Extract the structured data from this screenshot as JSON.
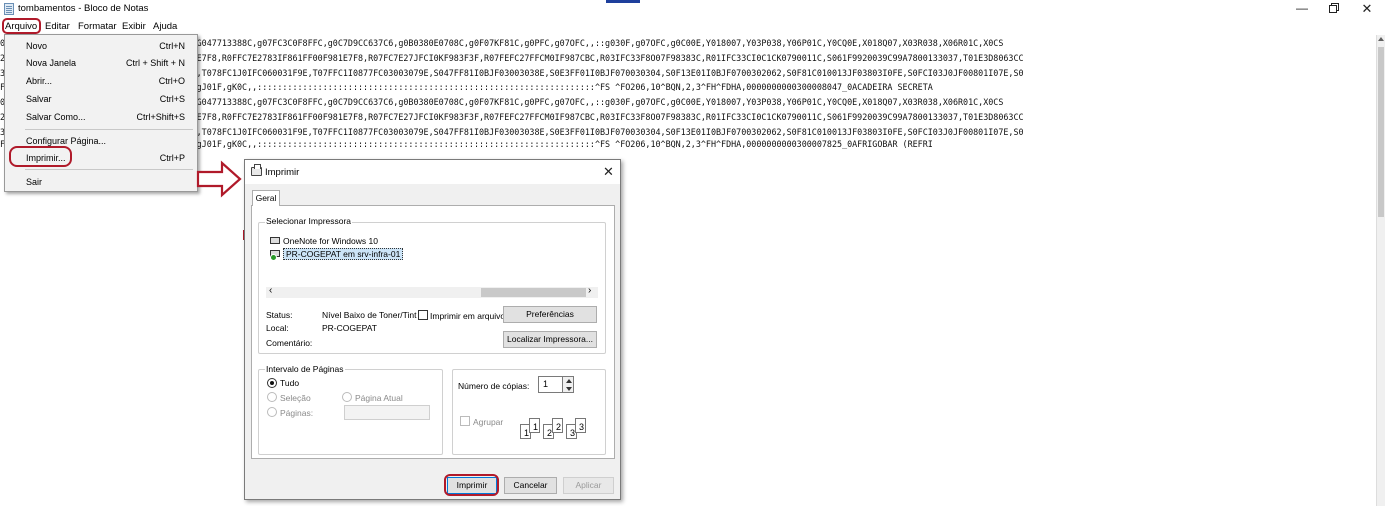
{
  "window": {
    "title": "tombamentos - Bloco de Notas",
    "minimize": "—",
    "close": "✕"
  },
  "menubar": {
    "arquivo": "Arquivo",
    "editar": "Editar",
    "formatar": "Formatar",
    "exibir": "Exibir",
    "ajuda": "Ajuda"
  },
  "file_menu": {
    "items": [
      {
        "label": "Novo",
        "shortcut": "Ctrl+N"
      },
      {
        "label": "Nova Janela",
        "shortcut": "Ctrl + Shift + N"
      },
      {
        "label": "Abrir...",
        "shortcut": "Ctrl+O"
      },
      {
        "label": "Salvar",
        "shortcut": "Ctrl+S"
      },
      {
        "label": "Salvar Como...",
        "shortcut": "Ctrl+Shift+S"
      },
      {
        "label": "Configurar Página...",
        "shortcut": ""
      },
      {
        "label": "Imprimir...",
        "shortcut": "Ctrl+P"
      },
      {
        "label": "Sair",
        "shortcut": ""
      }
    ]
  },
  "editor": {
    "lines": [
      "00,25,,:::::::::::::::::::::gH0161F1E,gG047713388C,g07FC3C0F8FFC,g0C7D9CC637C6,g0B0380E0708C,g0F07KF81C,g0PFC,g07OFC,,::g030F,g07OFC,g0C00E,Y018007,Y03P038,Y06P01C,Y0CQ0E,X018Q07,X03R038,X06R01C,X0CS",
      "27LF0JF7F987FFC,R0FE43E27EJFC03FF81F983E7F8,R0FFC7E2783IF861FF00F981E7F8,R07FC7E27JFCI0KF983F3F,R07FEFC27FFCM0IF987CBC,R03IFC33F8O07F98383C,R01IFC33CI0C1CK0790011C,S061F9920039C99A7800133037,T01E3D8063CC",
      "3I07FEI0600107FE,T0787C1I05IF81E0031FFC,T078FC1J0IFC060031F9E,T07FFC1I0877FC03003079E,S047FF81I0BJF03003038E,S0E3FF01I0BJF070030304,S0F13E01I0BJF0700302062,S0F81C010013JF03803I0FE,S0FCI03J0JF00801I07E,S0",
      "F81F07FF04,gG03FF0E1FF8,gI03C0F,gJ0738,gJ01F,gK0C,,:::::::::::::::::::::::::::::::::::::::::::::::::::::::::::::::::::^FS ^FO206,10^BQN,2,3^FH^FDHA,0000000000300008047_0ACADEIRA SECRETA",
      "00,25,,:::::::::::::::::::::gH0161F1E,gG047713388C,g07FC3C0F8FFC,g0C7D9CC637C6,g0B0380E0708C,g0F07KF81C,g0PFC,g07OFC,,::g030F,g07OFC,g0C00E,Y018007,Y03P038,Y06P01C,Y0CQ0E,X018Q07,X03R038,X06R01C,X0CS",
      "27LF0JF7F987FFC,R0FE43E27EJFC03FF81F983E7F8,R0FFC7E2783IF861FF00F981E7F8,R07FC7E27JFCI0KF983F3F,R07FEFC27FFCM0IF987CBC,R03IFC33F8O07F98383C,R01IFC33CI0C1CK0790011C,S061F9920039C99A7800133037,T01E3D8063CC",
      "3I07FEI0600107FE,T0787C1I05IF81E0031FFC,T078FC1J0IFC060031F9E,T07FFC1I0877FC03003079E,S047FF81I0BJF03003038E,S0E3FF01I0BJF070030304,S0F13E01I0BJF0700302062,S0F81C010013JF03803I0FE,S0FCI03J0JF00801I07E,S0",
      "F81F07FF04,gG03FF0E1FF8,gI03C0F,gJ0738,gJ01F,gK0C,,:::::::::::::::::::::::::::::::::::::::::::::::::::::::::::::::::::^FS ^FO206,10^BQN,2,3^FH^FDHA,0000000000300007825_0AFRIGOBAR (REFRI"
    ]
  },
  "print_dialog": {
    "title": "Imprimir",
    "close": "✕",
    "tab_general": "Geral",
    "select_printer_title": "Selecionar Impressora",
    "printers": [
      {
        "name": "OneNote for Windows 10",
        "selected": false
      },
      {
        "name": "PR-COGEPAT em srv-infra-01",
        "selected": true
      }
    ],
    "status_label": "Status:",
    "status_value": "Nível Baixo de Toner/Tint",
    "location_label": "Local:",
    "location_value": "PR-COGEPAT",
    "comment_label": "Comentário:",
    "print_to_file": "Imprimir em arquivo",
    "preferences_button": "Preferências",
    "find_printer_button": "Localizar Impressora...",
    "page_range_title": "Intervalo de Páginas",
    "range_all": "Tudo",
    "range_selection": "Seleção",
    "range_current": "Página Atual",
    "range_pages": "Páginas:",
    "copies_label": "Número de cópias:",
    "copies_value": "1",
    "collate_label": "Agrupar",
    "collate_pages": [
      "1",
      "1",
      "2",
      "2",
      "3",
      "3"
    ],
    "print_button": "Imprimir",
    "cancel_button": "Cancelar",
    "apply_button": "Aplicar"
  },
  "colors": {
    "annotation_red": "#b01a2a",
    "selection_blue": "#cce4f7",
    "accent_blue": "#0078d7"
  }
}
